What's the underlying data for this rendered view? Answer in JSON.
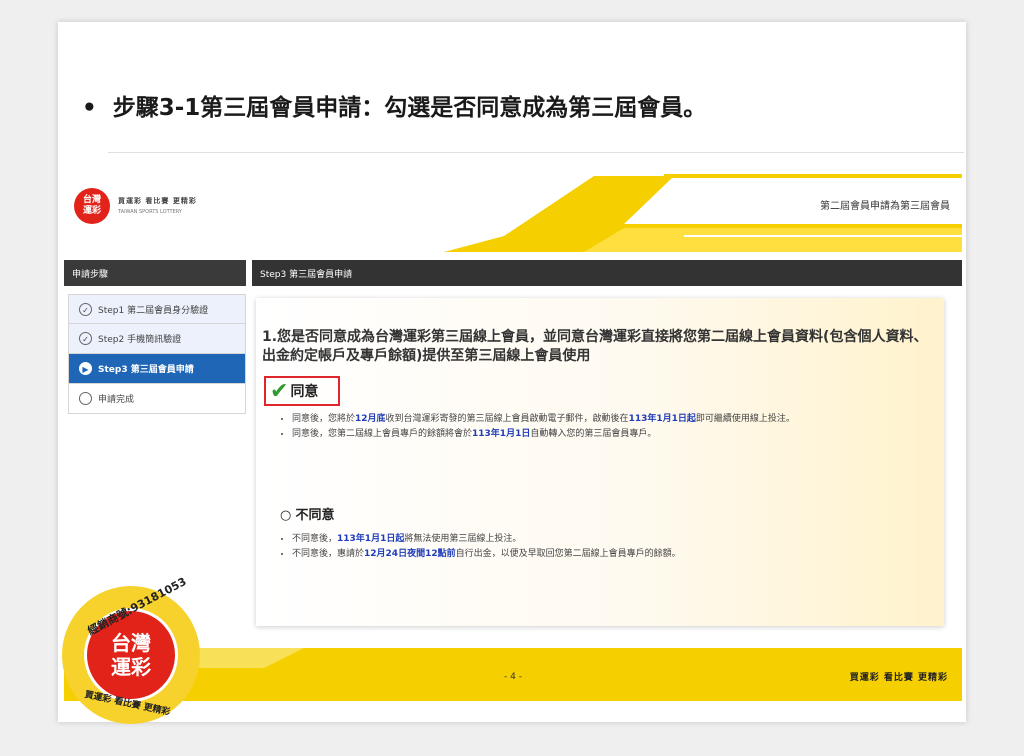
{
  "slide_title": "步驟3-1第三屆會員申請：勾選是否同意成為第三屆會員。",
  "header": {
    "logo_line1": "台灣",
    "logo_line2": "運彩",
    "logo_slogan": "買運彩 看比賽 更精彩",
    "logo_english": "TAIWAN SPORTS LOTTERY",
    "title": "第二屆會員申請為第三屆會員"
  },
  "bar": {
    "left": "申請步驟",
    "right": "Step3 第三屆會員申請"
  },
  "steps": [
    {
      "label": "Step1 第二屆會員身分驗證",
      "icon": "✓"
    },
    {
      "label": "Step2 手機簡訊驗證",
      "icon": "✓"
    },
    {
      "label": "Step3 第三屆會員申請",
      "icon": "▶"
    },
    {
      "label": "申請完成",
      "icon": ""
    }
  ],
  "question": "1.您是否同意成為台灣運彩第三屆線上會員，並同意台灣運彩直接將您第二屆線上會員資料(包含個人資料、出金約定帳戶及專戶餘額)提供至第三屆線上會員使用",
  "agree": {
    "label": "同意",
    "note1_a": "同意後，您將於",
    "note1_b": "12月底",
    "note1_c": "收到台灣運彩寄發的第三屆線上會員啟動電子郵件，啟動後在",
    "note1_d": "113年1月1日起",
    "note1_e": "即可繼續使用線上投注。",
    "note2_a": "同意後，您第二屆線上會員專戶的餘額將會於",
    "note2_b": "113年1月1日",
    "note2_c": "自動轉入您的第三屆會員專戶。"
  },
  "disagree": {
    "label": "不同意",
    "note1_a": "不同意後，",
    "note1_b": "113年1月1日起",
    "note1_c": "將無法使用第三屆線上投注。",
    "note2_a": "不同意後，惠請於",
    "note2_b": "12月24日夜間12點前",
    "note2_c": "自行出金，以便及早取回您第二屆線上會員專戶的餘額。"
  },
  "footer": {
    "page": "- 4 -",
    "slogan": "買運彩 看比賽 更精彩"
  },
  "badge": {
    "top": "經銷商號:93181053",
    "line1": "台灣",
    "line2": "運彩",
    "bottom": "買運彩 看比賽 更精彩"
  },
  "colors": {
    "accent_yellow": "#f5cf00",
    "brand_red": "#e2231a",
    "active_blue": "#1f67b6",
    "highlight_blue": "#1f3db8"
  }
}
